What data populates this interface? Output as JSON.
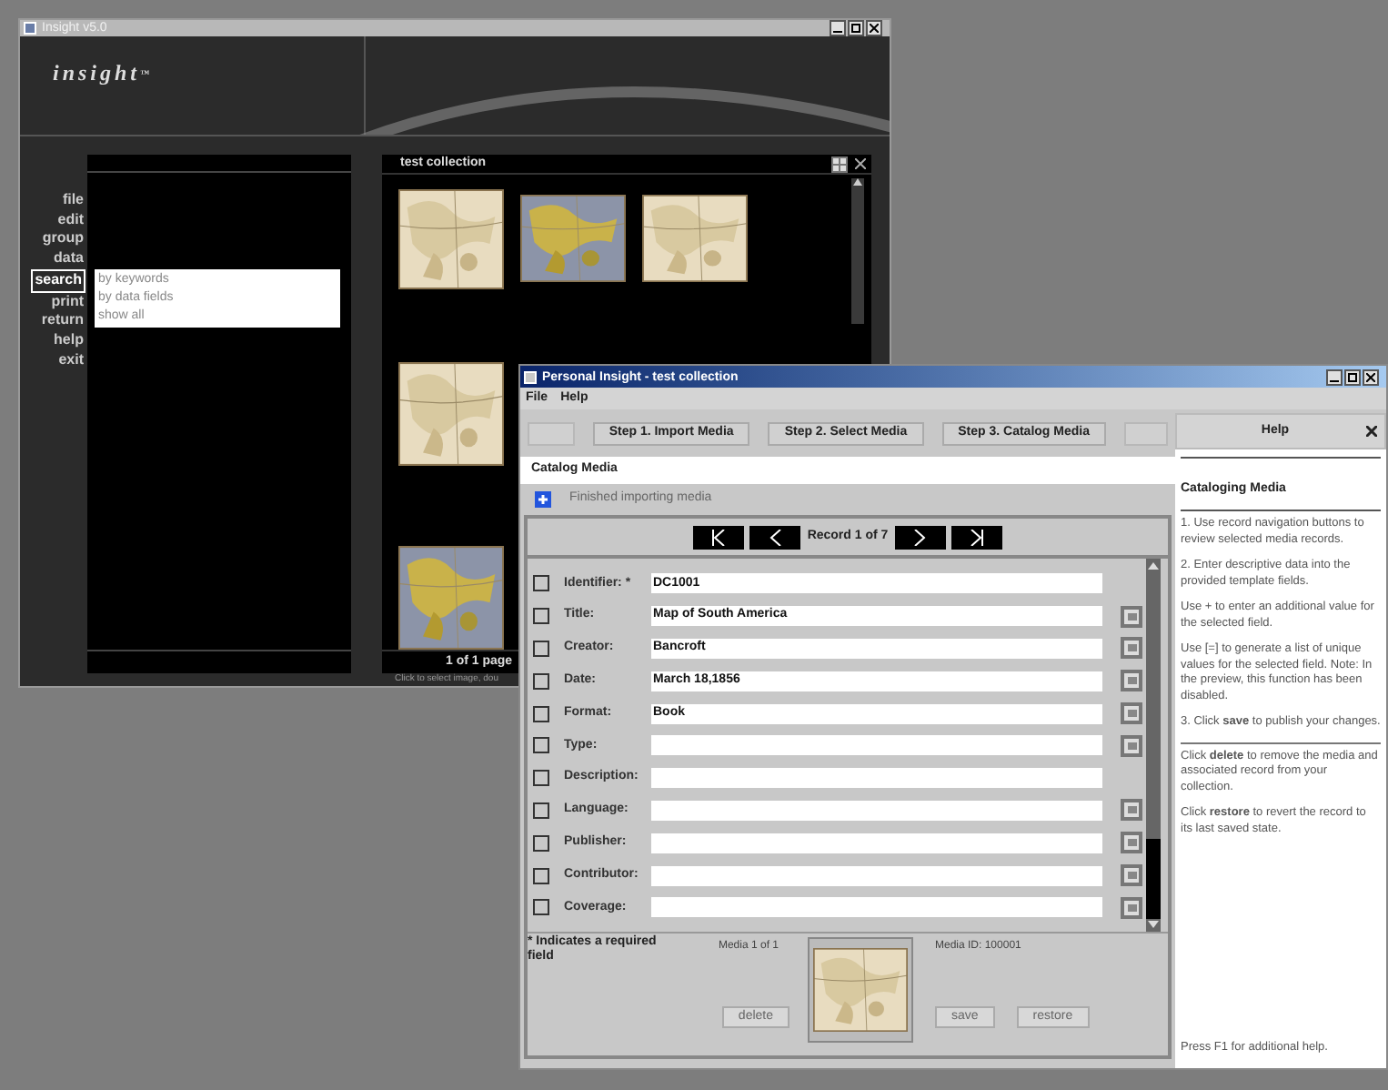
{
  "insight_window": {
    "title": "Insight v5.0",
    "logo": "insight",
    "logo_mark": "™",
    "menu": [
      {
        "label": "file",
        "selected": false
      },
      {
        "label": "edit",
        "selected": false
      },
      {
        "label": "group",
        "selected": false
      },
      {
        "label": "data",
        "selected": false
      },
      {
        "label": "search",
        "selected": true
      },
      {
        "label": "print",
        "selected": false
      },
      {
        "label": "return",
        "selected": false
      },
      {
        "label": "help",
        "selected": false
      },
      {
        "label": "exit",
        "selected": false
      }
    ],
    "search_menu": [
      "by keywords",
      "by data fields",
      "show all"
    ],
    "collection": {
      "title": "test collection",
      "page_label": "1 of 1 page",
      "hint": "Click to select image, dou"
    }
  },
  "catalog_window": {
    "title": "Personal Insight - test collection",
    "menu": [
      "File",
      "Help"
    ],
    "steps": [
      "Step 1. Import Media",
      "Step 2. Select Media",
      "Step 3. Catalog Media"
    ],
    "section_title": "Catalog Media",
    "status": "Finished importing media",
    "record_label": "Record 1 of 7",
    "fields": [
      {
        "label": "Identifier:",
        "required_mark": "*",
        "value": "DC1001",
        "checked": false,
        "list_button": false
      },
      {
        "label": "Title:",
        "value": "Map of South America",
        "checked": false,
        "list_button": true
      },
      {
        "label": "Creator:",
        "value": "Bancroft",
        "checked": false,
        "list_button": true
      },
      {
        "label": "Date:",
        "value": "March 18,1856",
        "checked": false,
        "list_button": true
      },
      {
        "label": "Format:",
        "value": "Book",
        "checked": false,
        "list_button": true
      },
      {
        "label": "Type:",
        "checked": false,
        "list_button": true
      },
      {
        "label": "Description:",
        "checked": false,
        "list_button": false
      },
      {
        "label": "Language:",
        "checked": false,
        "list_button": true
      },
      {
        "label": "Publisher:",
        "checked": false,
        "list_button": true
      },
      {
        "label": "Contributor:",
        "checked": false,
        "list_button": true
      },
      {
        "label": "Coverage:",
        "checked": false,
        "list_button": true
      }
    ],
    "required_note": "* Indicates a required field",
    "media_count": "Media 1 of 1",
    "media_id": "Media ID: 100001",
    "buttons": [
      "delete",
      "save",
      "restore"
    ]
  },
  "help": {
    "title": "Help",
    "heading": "Cataloging Media",
    "sections": [
      [
        "1. Use record navigation buttons to review selected media records.",
        "2. Enter descriptive data into the provided template fields.",
        "Use + to enter an additional value for the selected field.",
        "Use [=] to generate a list of unique values for the selected field. Note: In the preview, this function has been disabled.",
        "3. Click **save** to publish your changes."
      ],
      [
        "Click **delete** to remove the media and associated record from your collection.",
        "Click **restore** to revert the record to its last saved state."
      ]
    ],
    "footer": "Press F1 for additional help."
  }
}
